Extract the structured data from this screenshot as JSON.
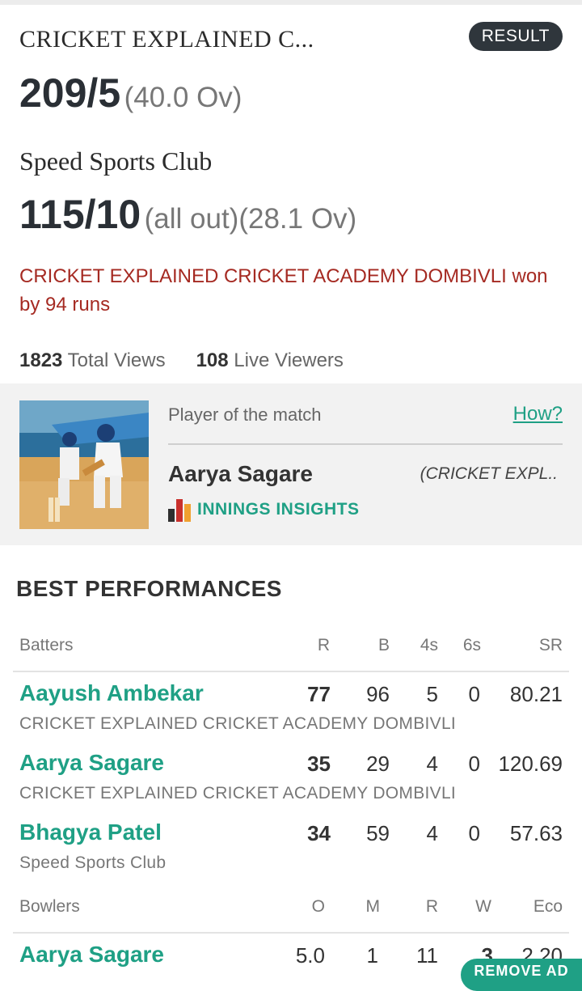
{
  "match": {
    "team1_short": "CRICKET EXPLAINED C...",
    "status_badge": "RESULT",
    "team1_score": "209/5",
    "team1_overs": "(40.0 Ov)",
    "team2_name": "Speed Sports Club",
    "team2_score": "115/10",
    "team2_extra": "(all out)(28.1 Ov)",
    "result_text": "CRICKET EXPLAINED CRICKET ACADEMY DOMBIVLI won by 94 runs",
    "total_views_count": "1823",
    "total_views_label": "Total Views",
    "live_viewers_count": "108",
    "live_viewers_label": "Live Viewers"
  },
  "player_of_match": {
    "label": "Player of the match",
    "how_link": "How?",
    "name": "Aarya Sagare",
    "team": "(CRICKET EXPL..",
    "insights_label": "INNINGS INSIGHTS"
  },
  "best_performances": {
    "title": "BEST PERFORMANCES",
    "batters_header": {
      "label": "Batters",
      "cols": [
        "R",
        "B",
        "4s",
        "6s",
        "SR"
      ]
    },
    "batters": [
      {
        "name": "Aayush Ambekar",
        "team": "CRICKET EXPLAINED CRICKET ACADEMY DOMBIVLI",
        "r": "77",
        "b": "96",
        "fours": "5",
        "sixes": "0",
        "sr": "80.21"
      },
      {
        "name": "Aarya Sagare",
        "team": "CRICKET EXPLAINED CRICKET ACADEMY DOMBIVLI",
        "r": "35",
        "b": "29",
        "fours": "4",
        "sixes": "0",
        "sr": "120.69"
      },
      {
        "name": "Bhagya Patel",
        "team": "Speed Sports Club",
        "r": "34",
        "b": "59",
        "fours": "4",
        "sixes": "0",
        "sr": "57.63"
      }
    ],
    "bowlers_header": {
      "label": "Bowlers",
      "cols": [
        "O",
        "M",
        "R",
        "W",
        "Eco"
      ]
    },
    "bowlers": [
      {
        "name": "Aarya Sagare",
        "o": "5.0",
        "m": "1",
        "r": "11",
        "w": "3",
        "eco": "2.20"
      }
    ]
  },
  "remove_ad_label": "REMOVE AD",
  "colors": {
    "accent": "#1fa085",
    "result": "#a52a22",
    "badge": "#2f363c"
  }
}
